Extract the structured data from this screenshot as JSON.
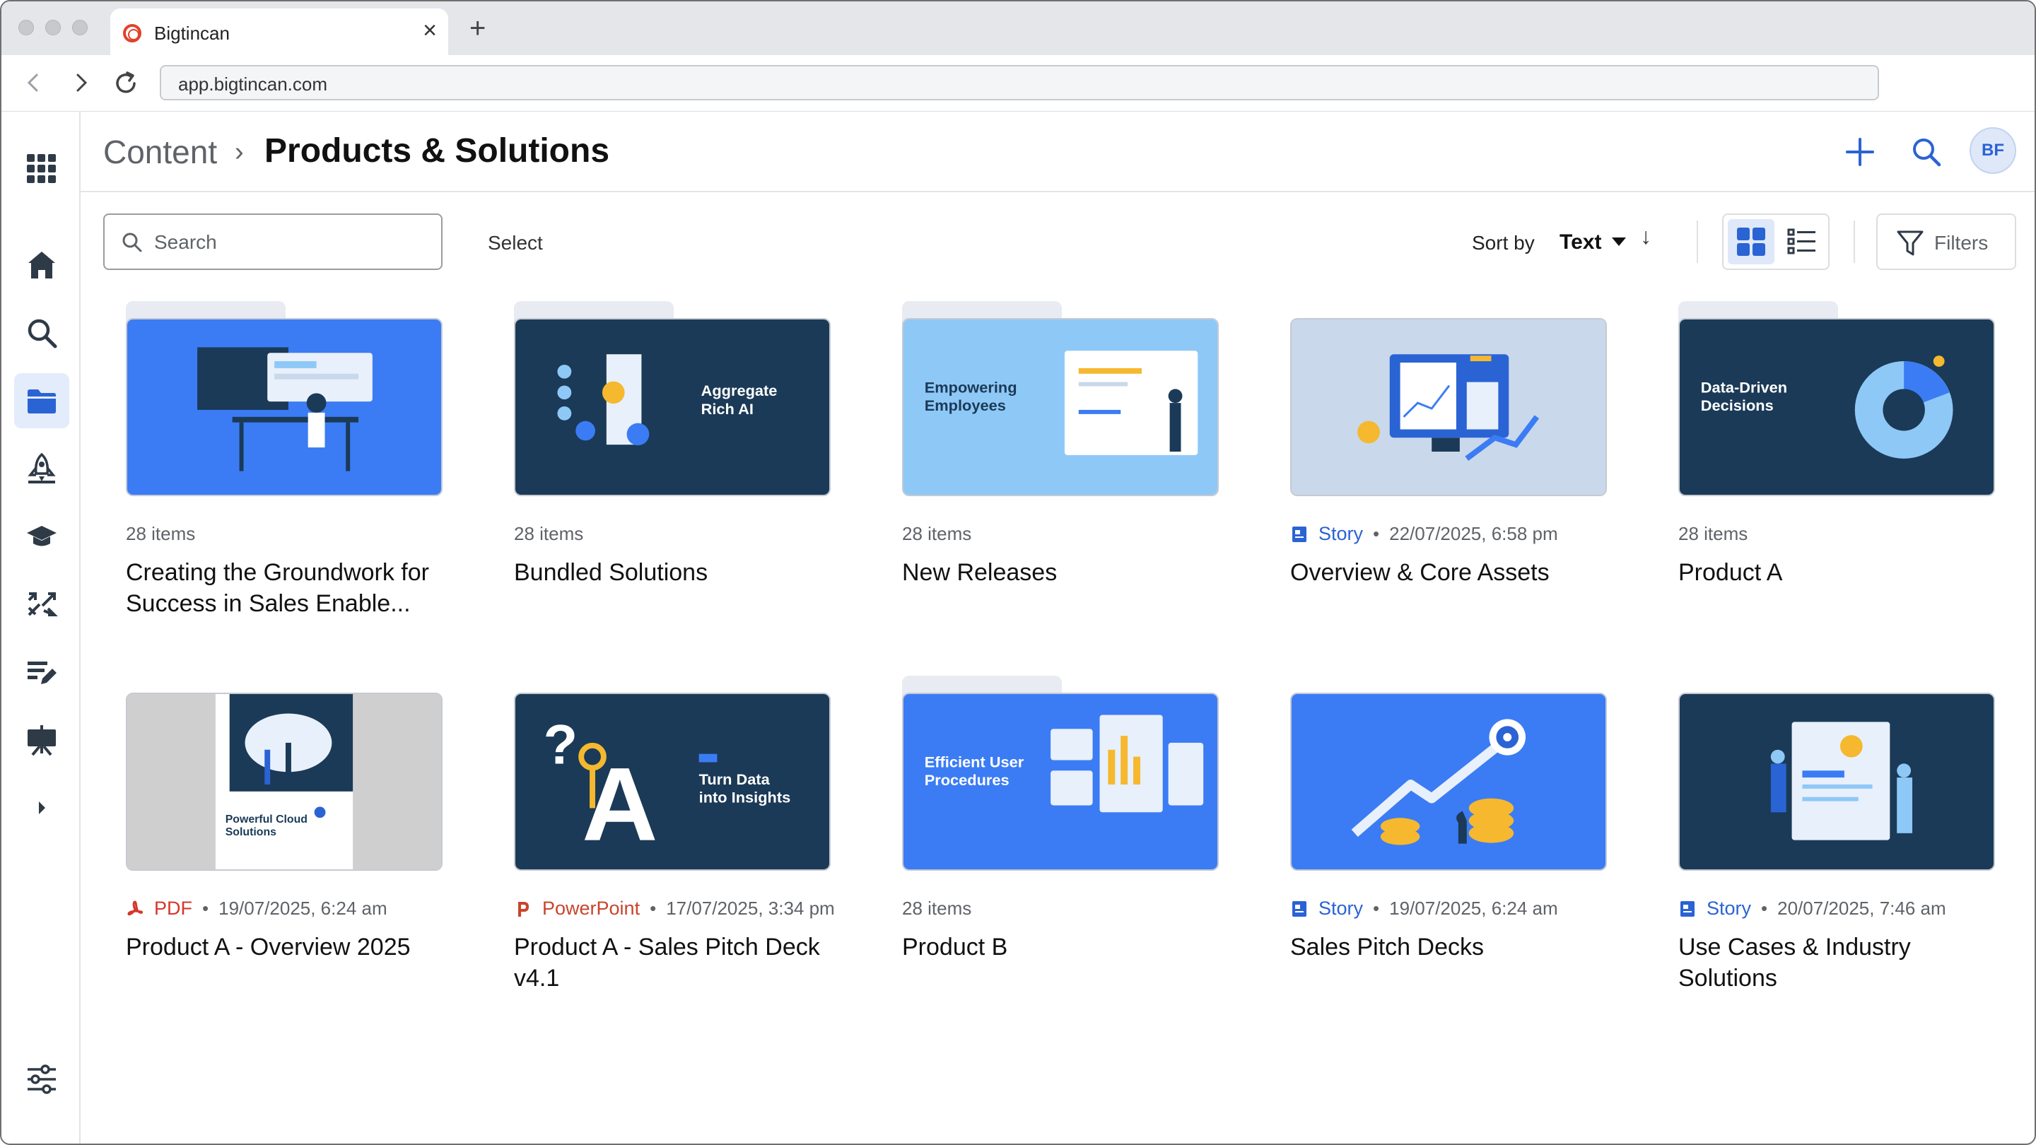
{
  "browser": {
    "tab_title": "Bigtincan",
    "tab_close": "×",
    "new_tab": "+",
    "url": "app.bigtincan.com"
  },
  "header": {
    "breadcrumb_root": "Content",
    "breadcrumb_sep": "›",
    "breadcrumb_current": "Products & Solutions",
    "avatar_initials": "BF"
  },
  "toolbar": {
    "search_placeholder": "Search",
    "select_label": "Select",
    "sort_by_label": "Sort by",
    "sort_by_value": "Text",
    "sort_direction": "↓",
    "filters_label": "Filters"
  },
  "cards": [
    {
      "kind": "folder",
      "meta": "28 items",
      "title": "Creating the Groundwork for Success in Sales Enable...",
      "thumb_bg": "#3b7cf5"
    },
    {
      "kind": "folder",
      "meta": "28 items",
      "title": "Bundled Solutions",
      "thumb_text": "Aggregate Rich AI",
      "thumb_bg": "#1b3a57"
    },
    {
      "kind": "folder",
      "meta": "28 items",
      "title": "New Releases",
      "thumb_text": "Empowering Employees",
      "thumb_bg": "#8ec8f7"
    },
    {
      "kind": "file",
      "type": "Story",
      "dot": "•",
      "date": "22/07/2025, 6:58 pm",
      "title": "Overview & Core Assets",
      "thumb_bg": "#c9d8ea"
    },
    {
      "kind": "folder",
      "meta": "28 items",
      "title": "Product A",
      "thumb_text": "Data-Driven Decisions",
      "thumb_bg": "#1b3a57"
    },
    {
      "kind": "file",
      "type": "PDF",
      "dot": "•",
      "date": "19/07/2025, 6:24 am",
      "title": "Product A - Overview 2025",
      "thumb_text": "Powerful Cloud Solutions",
      "thumb_bg": "#cfcfcf"
    },
    {
      "kind": "file",
      "type": "PowerPoint",
      "dot": "•",
      "date": "17/07/2025, 3:34 pm",
      "title": "Product A - Sales Pitch Deck v4.1",
      "thumb_text": "Turn Data into Insights",
      "thumb_bg": "#1b3a57"
    },
    {
      "kind": "folder",
      "meta": "28 items",
      "title": "Product B",
      "thumb_text": "Efficient User Procedures",
      "thumb_bg": "#3b7cf5"
    },
    {
      "kind": "file",
      "type": "Story",
      "dot": "•",
      "date": "19/07/2025, 6:24 am",
      "title": "Sales Pitch Decks",
      "thumb_bg": "#3b7cf5"
    },
    {
      "kind": "file",
      "type": "Story",
      "dot": "•",
      "date": "20/07/2025, 7:46 am",
      "title": "Use Cases & Industry Solutions",
      "thumb_bg": "#1b3a57"
    }
  ],
  "colors": {
    "accent": "#2a63d4",
    "navy": "#1b3a57",
    "blue": "#3b7cf5",
    "pdf_red": "#d6362b",
    "ppt_orange": "#c8452c"
  }
}
